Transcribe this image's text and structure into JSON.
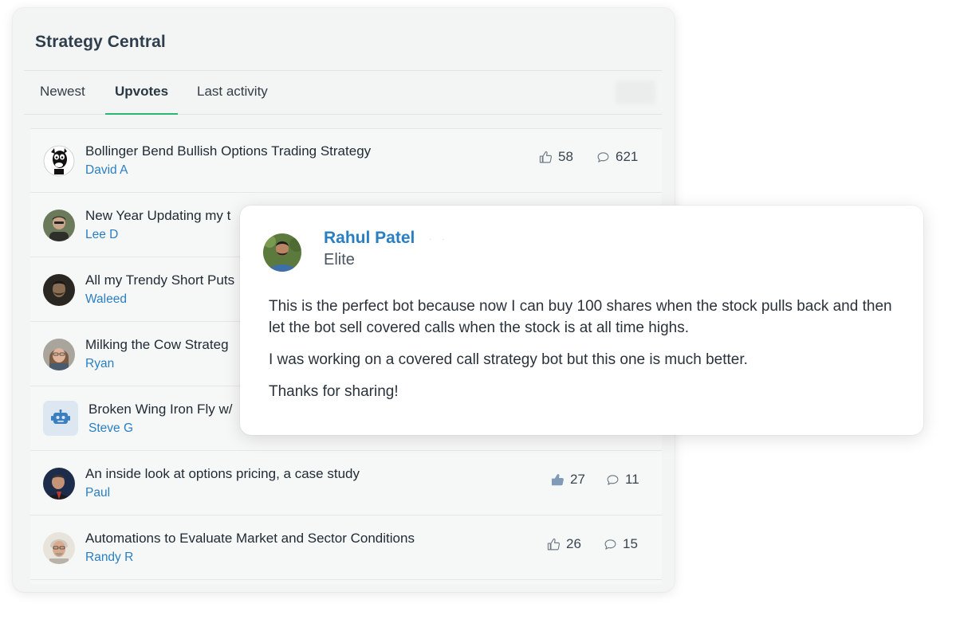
{
  "panel": {
    "title": "Strategy Central",
    "tabs": [
      {
        "label": "Newest",
        "active": false
      },
      {
        "label": "Upvotes",
        "active": true
      },
      {
        "label": "Last activity",
        "active": false
      }
    ]
  },
  "posts": [
    {
      "title": "Bollinger Bend Bullish Options Trading Strategy",
      "author": "David A",
      "upvotes": "58",
      "comments": "621",
      "avatar_icon": "cartoon-avatar"
    },
    {
      "title": "New Year Updating my t",
      "author": "Lee D",
      "avatar_icon": "photo-avatar"
    },
    {
      "title": "All my Trendy Short Puts",
      "author": "Waleed",
      "avatar_icon": "photo-avatar"
    },
    {
      "title": "Milking the Cow Strateg",
      "author": "Ryan",
      "avatar_icon": "photo-avatar"
    },
    {
      "title": "Broken Wing Iron Fly w/",
      "author": "Steve G",
      "avatar_icon": "robot-icon"
    },
    {
      "title": "An inside look at options pricing, a case study",
      "author": "Paul",
      "upvotes": "27",
      "comments": "11",
      "avatar_icon": "photo-avatar"
    },
    {
      "title": "Automations to Evaluate Market and Sector Conditions",
      "author": "Randy R",
      "upvotes": "26",
      "comments": "15",
      "avatar_icon": "photo-avatar"
    }
  ],
  "comment_card": {
    "name": "Rahul Patel",
    "role": "Elite",
    "paragraphs": [
      "This is the perfect bot because now I can buy 100 shares when the stock pulls back and then let the bot sell covered calls when the stock is at all time highs.",
      "I was working on a covered call strategy bot but this one is much better.",
      "Thanks for sharing!"
    ]
  },
  "colors": {
    "accent_green": "#2bb673",
    "link_blue": "#2a7fc3",
    "title_dark": "#2f3e4c"
  }
}
